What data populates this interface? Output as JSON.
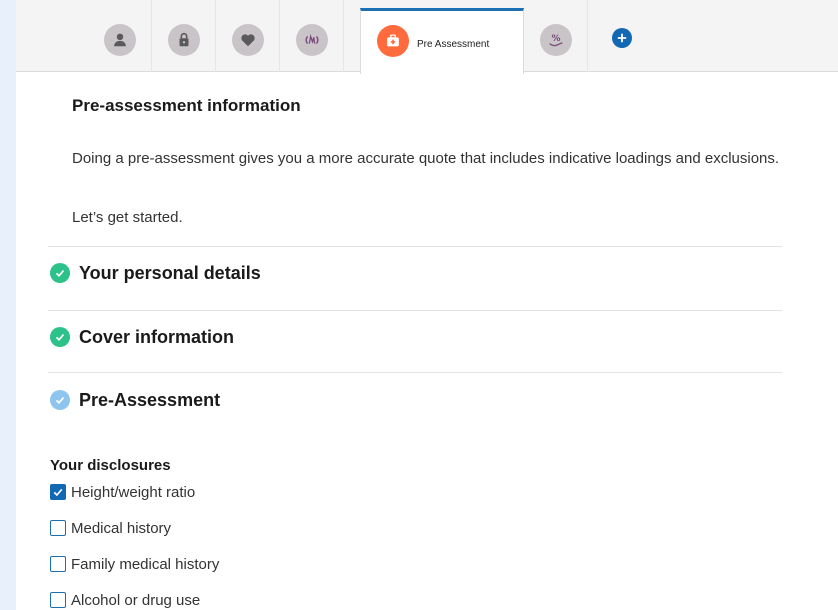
{
  "tabs": {
    "icons": [
      "person-icon",
      "lock-icon",
      "heart-icon",
      "pulse-icon",
      "medical-kit-icon",
      "percent-hand-icon"
    ],
    "active_label": "Pre Assessment"
  },
  "intro": {
    "title": "Pre-assessment information",
    "text": "Doing a pre-assessment gives you a more accurate quote that includes indicative loadings and exclusions.",
    "cta": "Let’s get started."
  },
  "steps": [
    {
      "label": "Your personal details",
      "status": "complete"
    },
    {
      "label": "Cover information",
      "status": "complete"
    },
    {
      "label": "Pre-Assessment",
      "status": "current"
    }
  ],
  "disclosures": {
    "title": "Your disclosures",
    "items": [
      {
        "label": "Height/weight ratio",
        "checked": true
      },
      {
        "label": "Medical history",
        "checked": false
      },
      {
        "label": "Family medical history",
        "checked": false
      },
      {
        "label": "Alcohol or drug use",
        "checked": false
      }
    ]
  },
  "colors": {
    "accent": "#1368b4",
    "complete_green": "#2ec28b",
    "current_blue": "#8ec5ee",
    "active_tab_icon": "#ff6b3d",
    "tab_icon_gray": "#c9c4c8"
  }
}
